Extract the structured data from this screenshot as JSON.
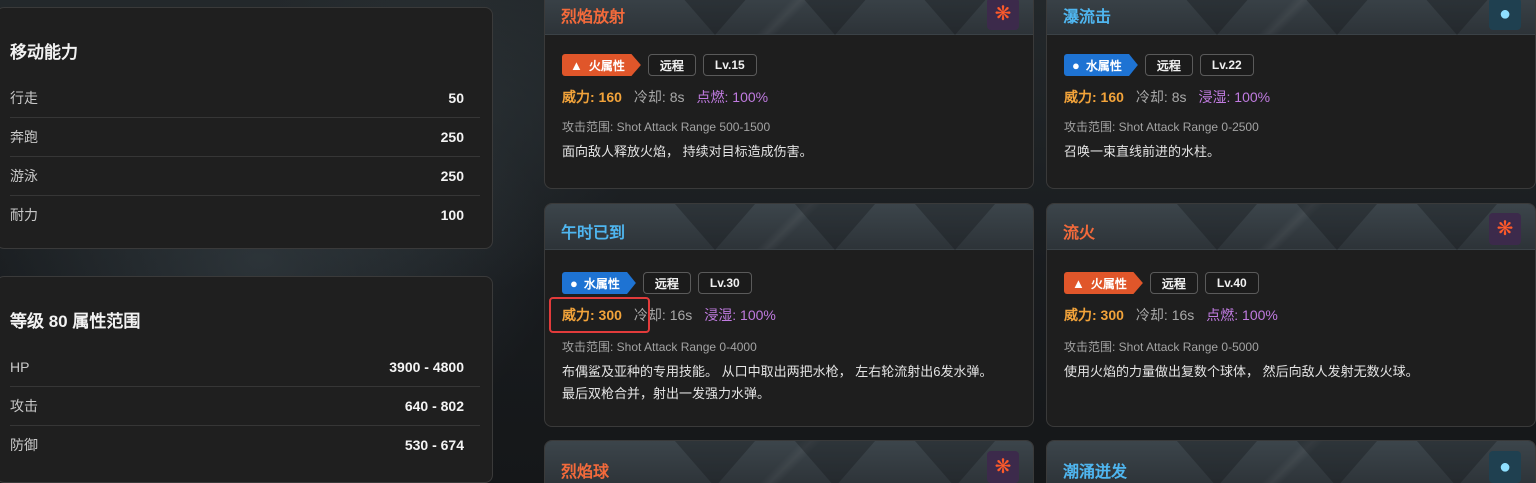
{
  "mobility": {
    "title": "移动能力",
    "rows": [
      {
        "label": "行走",
        "value": "50"
      },
      {
        "label": "奔跑",
        "value": "250"
      },
      {
        "label": "游泳",
        "value": "250"
      },
      {
        "label": "耐力",
        "value": "100"
      }
    ]
  },
  "level_stats": {
    "title": "等级 80 属性范围",
    "rows": [
      {
        "label": "HP",
        "value": "3900 - 4800"
      },
      {
        "label": "攻击",
        "value": "640 - 802"
      },
      {
        "label": "防御",
        "value": "530 - 674"
      }
    ]
  },
  "skills": [
    {
      "name": "烈焰放射",
      "element": "fire",
      "element_label": "火属性",
      "type": "远程",
      "level": "Lv.15",
      "power": "威力: 160",
      "cooldown": "冷却: 8s",
      "effect": "点燃: 100%",
      "range": "攻击范围: Shot Attack Range 500-1500",
      "desc": "面向敌人释放火焰， 持续对目标造成伤害。",
      "icon": "fire-icon"
    },
    {
      "name": "瀑流击",
      "element": "water",
      "element_label": "水属性",
      "type": "远程",
      "level": "Lv.22",
      "power": "威力: 160",
      "cooldown": "冷却: 8s",
      "effect": "浸湿: 100%",
      "range": "攻击范围: Shot Attack Range 0-2500",
      "desc": "召唤一束直线前进的水柱。",
      "icon": "water-icon"
    },
    {
      "name": "午时已到",
      "element": "water",
      "element_label": "水属性",
      "type": "远程",
      "level": "Lv.30",
      "power": "威力: 300",
      "cooldown": "冷却: 16s",
      "effect": "浸湿: 100%",
      "range": "攻击范围: Shot Attack Range 0-4000",
      "desc": "布偶鲨及亚种的专用技能。 从口中取出两把水枪， 左右轮流射出6发水弹。 最后双枪合并，射出一发强力水弹。",
      "icon": ""
    },
    {
      "name": "流火",
      "element": "fire",
      "element_label": "火属性",
      "type": "远程",
      "level": "Lv.40",
      "power": "威力: 300",
      "cooldown": "冷却: 16s",
      "effect": "点燃: 100%",
      "range": "攻击范围: Shot Attack Range 0-5000",
      "desc": "使用火焰的力量做出复数个球体， 然后向敌人发射无数火球。",
      "icon": "fire-icon"
    },
    {
      "name": "烈焰球",
      "element": "fire",
      "icon": "fire-icon"
    },
    {
      "name": "潮涌迸发",
      "element": "water",
      "icon": "water-icon"
    }
  ],
  "colors": {
    "fire": "#e0562a",
    "water": "#1e73d3",
    "power": "#f2a33a",
    "effect": "#c07be0",
    "highlight": "#e23b3b"
  }
}
